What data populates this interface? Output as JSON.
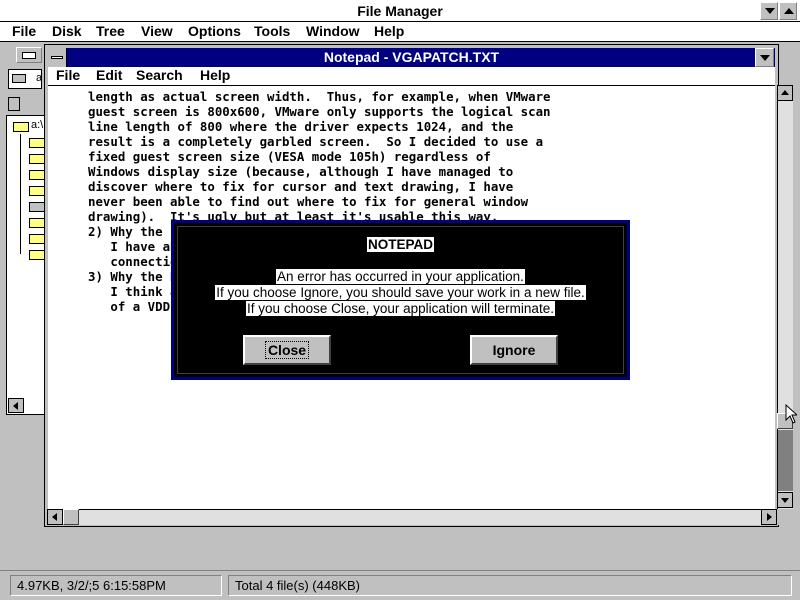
{
  "file_manager": {
    "title": "File Manager",
    "menu": [
      "File",
      "Disk",
      "Tree",
      "View",
      "Options",
      "Tools",
      "Window",
      "Help"
    ],
    "drive_label": "a",
    "tree_root": "a:\\"
  },
  "notepad": {
    "title": "Notepad - VGAPATCH.TXT",
    "menu": [
      "File",
      "Edit",
      "Search",
      "Help"
    ],
    "text_lines": [
      "length as actual screen width.  Thus, for example, when VMware",
      "guest screen is 800x600, VMware only supports the logical scan",
      "line length of 800 where the driver expects 1024, and the",
      "result is a completely garbled screen.  So I decided to use a",
      "fixed guest screen size (VESA mode 105h) regardless of",
      "Windows display size (because, although I have managed to",
      "discover where to fix for cursor and text drawing, I have",
      "never been able to find out where to fix for general window",
      "drawing).  It's ugly but at least it's usable this way.",
      "",
      "2) Why the fil",
      "",
      "   I have abs",
      "   connection",
      "",
      "3) Why the DOS",
      "",
      "   I think all",
      "   of a VDD to"
    ]
  },
  "dialog": {
    "title": "NOTEPAD",
    "line1": "An error has occurred in your application.",
    "line2": "If you choose Ignore, you should save your work in a new file.",
    "line3": "If you choose Close, your application will terminate.",
    "close_label": "Close",
    "ignore_label": "Ignore"
  },
  "status": {
    "left": "4.97KB, 3/2/;5 6:15:58PM",
    "right": "Total 4 file(s) (448KB)"
  },
  "colors": {
    "active_title": "#000080",
    "window_bg": "#c0c0c0",
    "dialog_bg": "#000000"
  }
}
